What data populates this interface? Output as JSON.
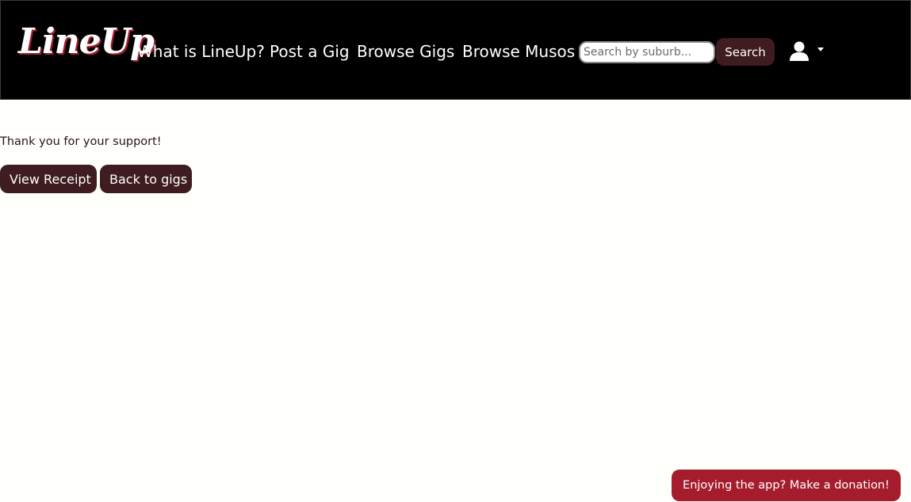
{
  "navbar": {
    "logo_text": "LineUp",
    "links": [
      {
        "label": "What is LineUp?"
      },
      {
        "label": "Post a Gig"
      },
      {
        "label": "Browse Gigs"
      },
      {
        "label": "Browse Musos"
      }
    ],
    "search": {
      "placeholder": "Search by suburb...",
      "value": "",
      "button_label": "Search"
    },
    "user_menu": {
      "icon": "user-icon",
      "caret_icon": "caret-down-icon"
    }
  },
  "main": {
    "message": "Thank you for your support!",
    "view_receipt_label": "View Receipt",
    "back_to_gigs_label": "Back to gigs"
  },
  "donate": {
    "label": "Enjoying the app? Make a donation!"
  },
  "colors": {
    "navbar_bg": "#000000",
    "page_bg": "#fffffb",
    "button_bg": "#3e1c1f",
    "donate_bg": "#a51d2d",
    "text": "#2a1419"
  }
}
